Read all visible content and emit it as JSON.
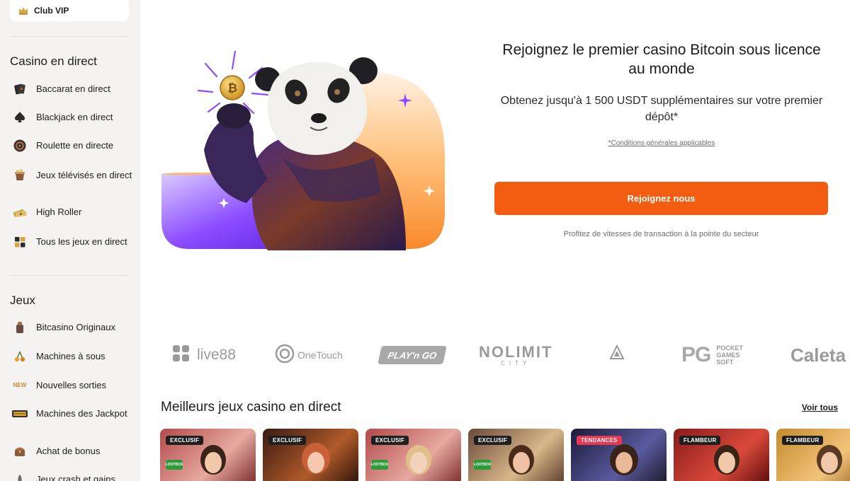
{
  "sidebar": {
    "vip": {
      "label": "Club VIP",
      "icon": "crown-icon"
    },
    "sections": [
      {
        "title": "Casino en direct",
        "items": [
          {
            "label": "Baccarat en direct",
            "icon": "playing-cards-icon"
          },
          {
            "label": "Blackjack en direct",
            "icon": "spade-icon"
          },
          {
            "label": "Roulette en directe",
            "icon": "roulette-icon"
          },
          {
            "label": "Jeux télévisés en direct",
            "icon": "tv-show-icon"
          },
          {
            "label": "High Roller",
            "icon": "money-stack-icon"
          },
          {
            "label": "Tous les jeux en direct",
            "icon": "grid-games-icon"
          }
        ]
      },
      {
        "title": "Jeux",
        "items": [
          {
            "label": "Bitcasino Originaux",
            "icon": "originals-icon"
          },
          {
            "label": "Machines à sous",
            "icon": "cherries-icon"
          },
          {
            "label": "Nouvelles sorties",
            "icon": "new-badge-icon",
            "icon_text": "NEW"
          },
          {
            "label": "Machines des Jackpot",
            "icon": "jackpot-icon"
          },
          {
            "label": "Achat de bonus",
            "icon": "bonus-chest-icon"
          },
          {
            "label": "Jeux crash et gains",
            "icon": "rocket-icon"
          }
        ]
      }
    ]
  },
  "hero": {
    "title": "Rejoignez le premier casino Bitcoin sous licence au monde",
    "subtitle": "Obtenez jusqu'à 1 500 USDT supplémentaires sur votre premier dépôt*",
    "terms": "*Conditions générales applicables",
    "cta": "Rejoignez nous",
    "note": "Profitez de vitesses de transaction à la pointe du secteur",
    "accent": "#f25d12",
    "art": "panda-holding-bitcoin"
  },
  "providers": [
    {
      "name": "live88",
      "icon": "live88-logo"
    },
    {
      "name": "OneTouch",
      "icon": "onetouch-logo"
    },
    {
      "name": "PLAY'n GO",
      "icon": "playngo-logo"
    },
    {
      "name": "NOLIMIT",
      "sub": "CITY",
      "icon": "nolimit-city-logo"
    },
    {
      "name": "",
      "icon": "triangle-provider-logo"
    },
    {
      "name": "POCKET GAMES SOFT",
      "icon": "pg-soft-logo",
      "mark": "PG"
    },
    {
      "name": "Caleta",
      "icon": "caleta-logo"
    }
  ],
  "games": {
    "title": "Meilleurs jeux casino en direct",
    "see_all": "Voir tous",
    "cards": [
      {
        "badge": "EXCLUSIF",
        "lootbox": "LOOTBOX",
        "badge_color": "#1f1f1f"
      },
      {
        "badge": "EXCLUSIF",
        "badge_color": "#1f1f1f"
      },
      {
        "badge": "EXCLUSIF",
        "lootbox": "LOOTBOX",
        "badge_color": "#1f1f1f"
      },
      {
        "badge": "EXCLUSIF",
        "lootbox": "LOOTBOX",
        "badge_color": "#1f1f1f"
      },
      {
        "badge": "TENDANCES",
        "badge_color": "#e8374f"
      },
      {
        "badge": "FLAMBEUR",
        "badge_color": "#1f1f1f"
      },
      {
        "badge": "FLAMBEUR",
        "badge_color": "#1f1f1f"
      }
    ]
  }
}
